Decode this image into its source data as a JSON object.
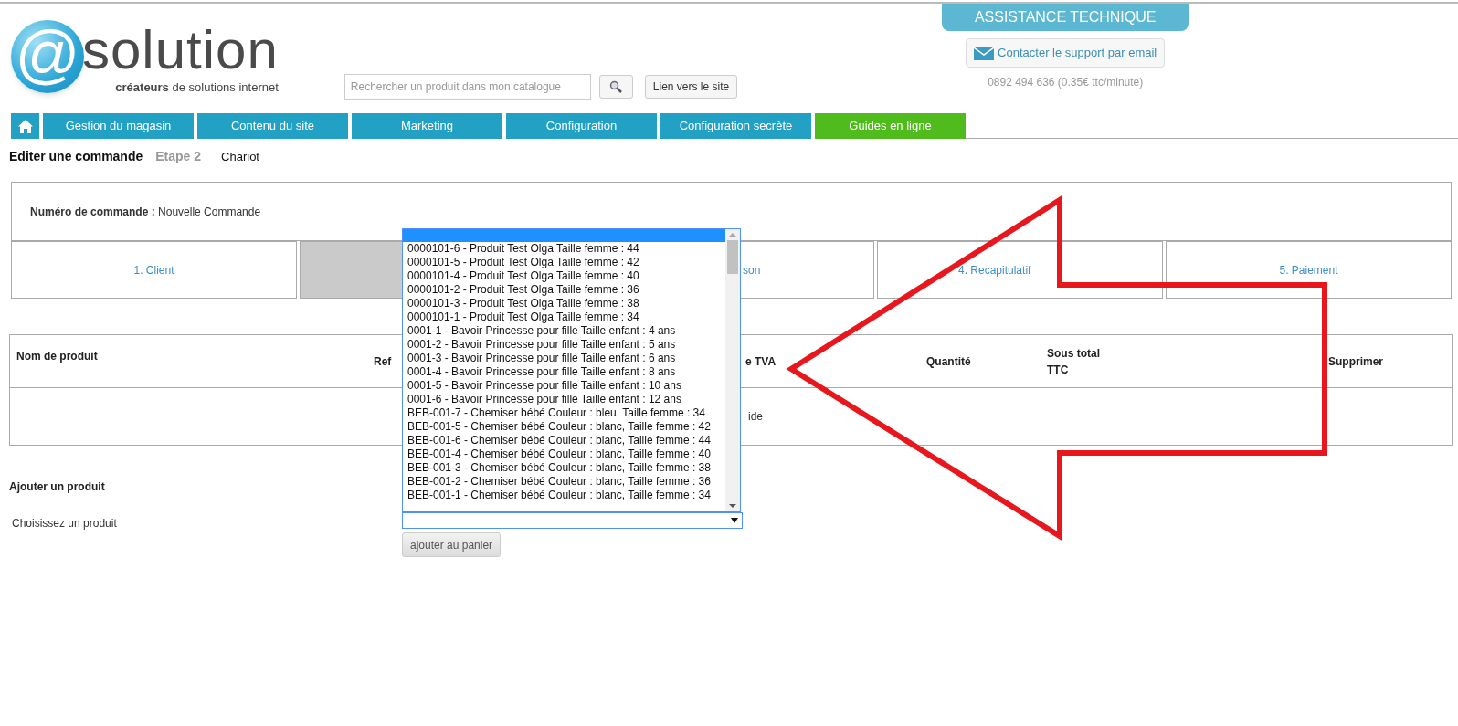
{
  "logo": {
    "mark": "@",
    "name": "solution",
    "tagline": "**créateurs** de solutions internet"
  },
  "search": {
    "placeholder": "Rechercher un produit dans mon catalogue"
  },
  "site_link": "Lien vers le site",
  "support": {
    "title": "ASSISTANCE TECHNIQUE",
    "email_button": "Contacter le support par email",
    "phone": "0892 494 636 (0.35€ ttc/minute)"
  },
  "nav": [
    {
      "kind": "home"
    },
    {
      "kind": "tab",
      "label": "Gestion du magasin"
    },
    {
      "kind": "tab",
      "label": "Contenu du site"
    },
    {
      "kind": "tab",
      "label": "Marketing"
    },
    {
      "kind": "tab",
      "label": "Configuration"
    },
    {
      "kind": "tab",
      "label": "Configuration secrète"
    },
    {
      "kind": "guide",
      "label": "Guides en ligne"
    }
  ],
  "breadcrumb": {
    "title": "Editer une commande",
    "step": "Etape 2",
    "section": "Chariot"
  },
  "order": {
    "label": "Numéro de commande :",
    "value": "Nouvelle Commande"
  },
  "steps": [
    {
      "label": "1. Client",
      "selected": false
    },
    {
      "selected": true
    },
    {
      "label": "son",
      "selected": false
    },
    {
      "label": "4. Recapitulatif",
      "selected": false
    },
    {
      "label": "5. Paiement",
      "selected": false
    }
  ],
  "table": {
    "columns": [
      "Nom de produit",
      "Ref",
      "e TVA",
      "Quantité",
      "Sous total TTC",
      "Supprimer"
    ],
    "empty_text": "ide"
  },
  "add_product": {
    "title": "Ajouter un produit",
    "label": "Choisissez un produit",
    "button": "ajouter au panier"
  },
  "dropdown": {
    "blank_selected": true,
    "options": [
      {
        "label": "0000101-6 - Produit Test Olga Taille femme : 44",
        "selected": false
      },
      {
        "label": "0000101-5 - Produit Test Olga Taille femme : 42",
        "selected": false
      },
      {
        "label": "0000101-4 - Produit Test Olga Taille femme : 40",
        "selected": false
      },
      {
        "label": "0000101-2 - Produit Test Olga Taille femme : 36",
        "selected": false
      },
      {
        "label": "0000101-3 - Produit Test Olga Taille femme : 38",
        "selected": false
      },
      {
        "label": "0000101-1 - Produit Test Olga Taille femme : 34",
        "selected": false
      },
      {
        "label": "0001-1 - Bavoir Princesse pour fille Taille enfant : 4 ans",
        "selected": false
      },
      {
        "label": "0001-2 - Bavoir Princesse pour fille Taille enfant : 5 ans",
        "selected": false
      },
      {
        "label": "0001-3 - Bavoir Princesse pour fille Taille enfant : 6 ans",
        "selected": false
      },
      {
        "label": "0001-4 - Bavoir Princesse pour fille Taille enfant : 8 ans",
        "selected": false
      },
      {
        "label": "0001-5 - Bavoir Princesse pour fille Taille enfant : 10 ans",
        "selected": false
      },
      {
        "label": "0001-6 - Bavoir Princesse pour fille Taille enfant : 12 ans",
        "selected": false
      },
      {
        "label": "BEB-001-7 - Chemiser bébé Couleur : bleu,  Taille femme : 34",
        "selected": false
      },
      {
        "label": "BEB-001-5 - Chemiser bébé Couleur : blanc,  Taille femme : 42",
        "selected": false
      },
      {
        "label": "BEB-001-6 - Chemiser bébé Couleur : blanc,  Taille femme : 44",
        "selected": false
      },
      {
        "label": "BEB-001-4 - Chemiser bébé Couleur : blanc,  Taille femme : 40",
        "selected": false
      },
      {
        "label": "BEB-001-3 - Chemiser bébé Couleur : blanc,  Taille femme : 38",
        "selected": false
      },
      {
        "label": "BEB-001-2 - Chemiser bébé Couleur : blanc,  Taille femme : 36",
        "selected": false
      },
      {
        "label": "BEB-001-1 - Chemiser bébé Couleur : blanc,  Taille femme : 34",
        "selected": false
      }
    ]
  }
}
